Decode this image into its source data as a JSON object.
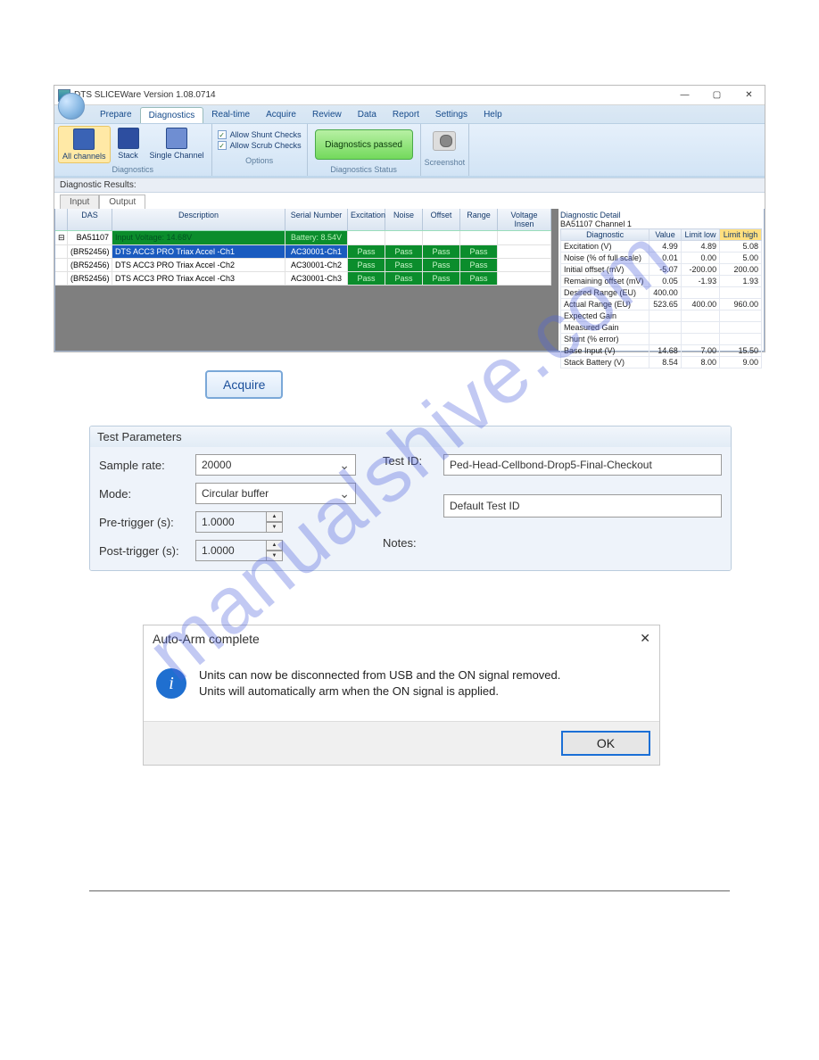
{
  "watermark": "manualshive.com",
  "app": {
    "title": "DTS SLICEWare Version 1.08.0714",
    "menus": [
      "Prepare",
      "Diagnostics",
      "Real-time",
      "Acquire",
      "Review",
      "Data",
      "Report",
      "Settings",
      "Help"
    ],
    "active_menu_index": 1,
    "ribbon": {
      "diagnostics": {
        "all_channels": "All channels",
        "stack": "Stack",
        "single_channel": "Single Channel",
        "group_label": "Diagnostics"
      },
      "options": {
        "allow_shunt": "Allow Shunt Checks",
        "allow_scrub": "Allow Scrub Checks",
        "group_label": "Options",
        "shunt_checked": true,
        "scrub_checked": true
      },
      "status": {
        "text": "Diagnostics passed",
        "group_label": "Diagnostics Status"
      },
      "screenshot": {
        "label": "Screenshot"
      }
    },
    "subheader": "Diagnostic Results:",
    "tabs": [
      "Input",
      "Output"
    ],
    "active_tab_index": 1,
    "grid": {
      "headers": [
        "",
        "DAS",
        "Description",
        "Serial Number",
        "Excitation",
        "Noise",
        "Offset",
        "Range",
        "Voltage Insen"
      ],
      "rows": [
        {
          "das": "BA51107",
          "desc": "Input Voltage: 14.68V",
          "sn": "",
          "cells": [
            "",
            "",
            "",
            ""
          ],
          "first_green": true
        },
        {
          "das": "(BR52456)",
          "desc": "DTS ACC3 PRO Triax Accel -Ch1",
          "sn": "AC30001-Ch1",
          "cells": [
            "Pass",
            "Pass",
            "Pass",
            "Pass"
          ],
          "selected": true
        },
        {
          "das": "(BR52456)",
          "desc": "DTS ACC3 PRO Triax Accel -Ch2",
          "sn": "AC30001-Ch2",
          "cells": [
            "Pass",
            "Pass",
            "Pass",
            "Pass"
          ]
        },
        {
          "das": "(BR52456)",
          "desc": "DTS ACC3 PRO Triax Accel -Ch3",
          "sn": "AC30001-Ch3",
          "cells": [
            "Pass",
            "Pass",
            "Pass",
            "Pass"
          ]
        }
      ]
    },
    "detail": {
      "title": "Diagnostic Detail",
      "sub": "BA51107 Channel 1",
      "headers": [
        "Diagnostic",
        "Value",
        "Limit low",
        "Limit high"
      ],
      "rows": [
        [
          "Excitation (V)",
          "4.99",
          "4.89",
          "5.08"
        ],
        [
          "Noise (% of full scale)",
          "0.01",
          "0.00",
          "5.00"
        ],
        [
          "Initial offset (mV)",
          "-5.07",
          "-200.00",
          "200.00"
        ],
        [
          "Remaining offset (mV)",
          "0.05",
          "-1.93",
          "1.93"
        ],
        [
          "Desired Range (EU)",
          "400.00",
          "",
          ""
        ],
        [
          "Actual Range (EU)",
          "523.65",
          "400.00",
          "960.00"
        ],
        [
          "Expected Gain",
          "",
          "",
          ""
        ],
        [
          "Measured Gain",
          "",
          "",
          ""
        ],
        [
          "Shunt (% error)",
          "",
          "",
          ""
        ],
        [
          "Base Input (V)",
          "14.68",
          "7.00",
          "15.50"
        ],
        [
          "Stack Battery (V)",
          "8.54",
          "8.00",
          "9.00"
        ]
      ]
    }
  },
  "acquire_button": "Acquire",
  "test_params": {
    "title": "Test Parameters",
    "labels": {
      "sample_rate": "Sample rate:",
      "mode": "Mode:",
      "pre": "Pre-trigger (s):",
      "post": "Post-trigger (s):",
      "test_id": "Test ID:",
      "notes": "Notes:"
    },
    "sample_rate": "20000",
    "mode": "Circular buffer",
    "pre": "1.0000",
    "post": "1.0000",
    "test_id": "Ped-Head-Cellbond-Drop5-Final-Checkout",
    "default_test_id": "Default Test ID"
  },
  "msgbox": {
    "title": "Auto-Arm complete",
    "body_line1": "Units can now be disconnected from USB and the ON signal removed.",
    "body_line2": "Units will automatically arm when the ON signal is applied.",
    "ok": "OK"
  }
}
